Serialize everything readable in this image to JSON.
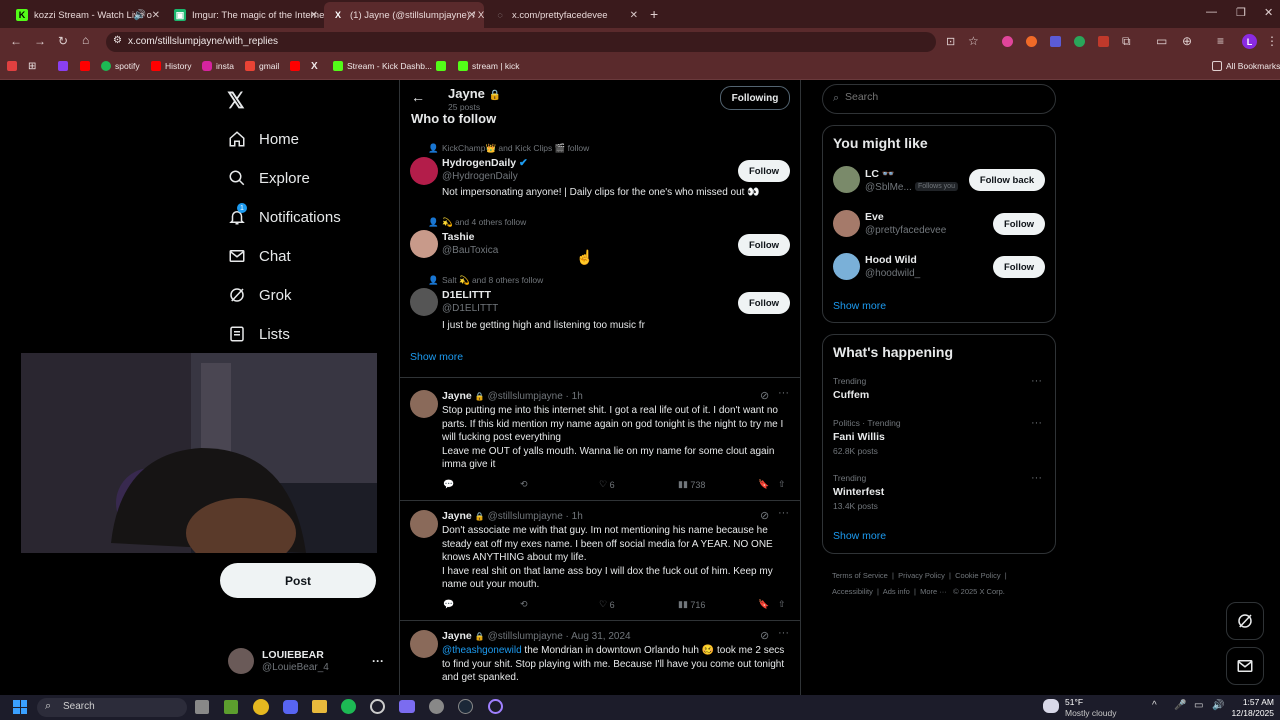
{
  "browser": {
    "tabs": [
      {
        "title": "kozzi Stream - Watch Live o",
        "fav": "K",
        "color": "#53fc18"
      },
      {
        "title": "Imgur: The magic of the Interne",
        "fav": "▣",
        "color": "#1bb76e"
      },
      {
        "title": "(1) Jayne (@stillslumpjayne) / X",
        "fav": "X",
        "color": "#ffffff"
      },
      {
        "title": "x.com/prettyfacedevee",
        "fav": "◌",
        "color": "#aaaaaa"
      }
    ],
    "url": "x.com/stillslumpjayne/with_replies",
    "bookmarks": [
      "spotify",
      "History",
      "insta",
      "gmail",
      "Stream - Kick Dashb...",
      "stream | kick"
    ],
    "all_bookmarks": "All Bookmarks"
  },
  "nav": {
    "items": [
      {
        "label": "Home",
        "icon": "home-icon"
      },
      {
        "label": "Explore",
        "icon": "search-icon"
      },
      {
        "label": "Notifications",
        "icon": "bell-icon",
        "badge": "1"
      },
      {
        "label": "Chat",
        "icon": "mail-icon"
      },
      {
        "label": "Grok",
        "icon": "grok-icon"
      },
      {
        "label": "Lists",
        "icon": "list-icon"
      }
    ],
    "post_label": "Post",
    "account": {
      "name": "LOUIEBEAR",
      "handle": "@LouieBear_4",
      "more": "···"
    }
  },
  "profile_header": {
    "name": "Jayne",
    "posts": "25 posts",
    "following_label": "Following",
    "section": "Who to follow"
  },
  "who_to_follow": [
    {
      "social": "KickChamp👑 and Kick Clips 🎬 follow",
      "name": "HydrogenDaily",
      "verified": true,
      "handle": "@HydrogenDaily",
      "bio": "Not impersonating anyone! | Daily clips for the one's who missed out 👀",
      "button": "Follow"
    },
    {
      "social": "💫 and 4 others follow",
      "name": "Tashie",
      "verified": false,
      "handle": "@BauToxica",
      "bio": "",
      "button": "Follow"
    },
    {
      "social": "Salt 💫 and 8 others follow",
      "name": "D1ELITTT",
      "verified": false,
      "handle": "@D1ELITTT",
      "bio": "I just be getting high and listening too music fr",
      "button": "Follow"
    }
  ],
  "show_more": "Show more",
  "posts": [
    {
      "name": "Jayne",
      "meta": "@stillslumpjayne · 1h",
      "text": "Stop putting me into this internet shit. I got a real life out of it. I don't want no parts. If this kid mention my name again on god tonight is the night to try me I will fucking post everything\nLeave me OUT of yalls mouth. Wanna lie on my name for some clout again imma give it",
      "likes": "6",
      "views": "738"
    },
    {
      "name": "Jayne",
      "meta": "@stillslumpjayne · 1h",
      "text": "Don't associate me with that guy. Im not mentioning his name because he steady eat off my exes name. I been off social media for A YEAR. NO ONE knows ANYTHING about my life.\nI have real shit on that lame ass boy I will dox the fuck out of him. Keep my name out your mouth.",
      "likes": "6",
      "views": "716"
    },
    {
      "name": "Jayne",
      "meta": "@stillslumpjayne · Aug 31, 2024",
      "mention": "@theashgonewild",
      "text": " the Mondrian in downtown Orlando huh 🥴 took me 2 secs to find your shit. Stop playing with me. Because I'll have you come out tonight and get spanked.",
      "likes": "",
      "views": ""
    }
  ],
  "search": {
    "placeholder": "Search"
  },
  "you_might_like": {
    "title": "You might like",
    "items": [
      {
        "name": "LC 👓",
        "handle": "@SblMe...",
        "tag": "Follows you",
        "button": "Follow back"
      },
      {
        "name": "Eve",
        "handle": "@prettyfacedevee",
        "tag": "",
        "button": "Follow"
      },
      {
        "name": "Hood Wild",
        "handle": "@hoodwild_",
        "tag": "",
        "button": "Follow"
      }
    ],
    "show_more": "Show more"
  },
  "whats_happening": {
    "title": "What's happening",
    "trends": [
      {
        "meta": "Trending",
        "name": "Cuffem",
        "count": ""
      },
      {
        "meta": "Politics · Trending",
        "name": "Fani Willis",
        "count": "62.8K posts"
      },
      {
        "meta": "Trending",
        "name": "Winterfest",
        "count": "13.4K posts"
      }
    ],
    "show_more": "Show more"
  },
  "footer": {
    "links": [
      "Terms of Service",
      "Privacy Policy",
      "Cookie Policy",
      "Accessibility",
      "Ads info",
      "More ···",
      "© 2025 X Corp."
    ]
  },
  "taskbar": {
    "search": "Search",
    "weather_temp": "51°F",
    "weather_desc": "Mostly cloudy",
    "time": "1:57 AM",
    "date": "12/18/2025"
  }
}
